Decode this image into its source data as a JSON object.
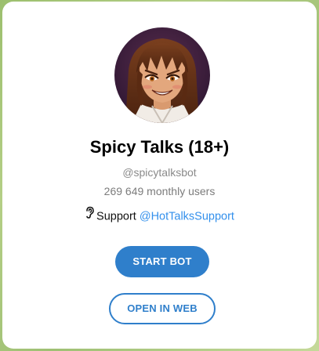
{
  "bot": {
    "name": "Spicy Talks (18+)",
    "username": "@spicytalksbot",
    "monthly_users": "269 649 monthly users",
    "support_prefix": "Support",
    "support_link": "@HotTalksSupport",
    "avatar_icon": "anime-girl-avatar"
  },
  "actions": {
    "start_label": "START BOT",
    "web_label": "OPEN IN WEB"
  },
  "colors": {
    "accent": "#2f7fcb",
    "link": "#3390ec",
    "background": "#a8c87c"
  }
}
